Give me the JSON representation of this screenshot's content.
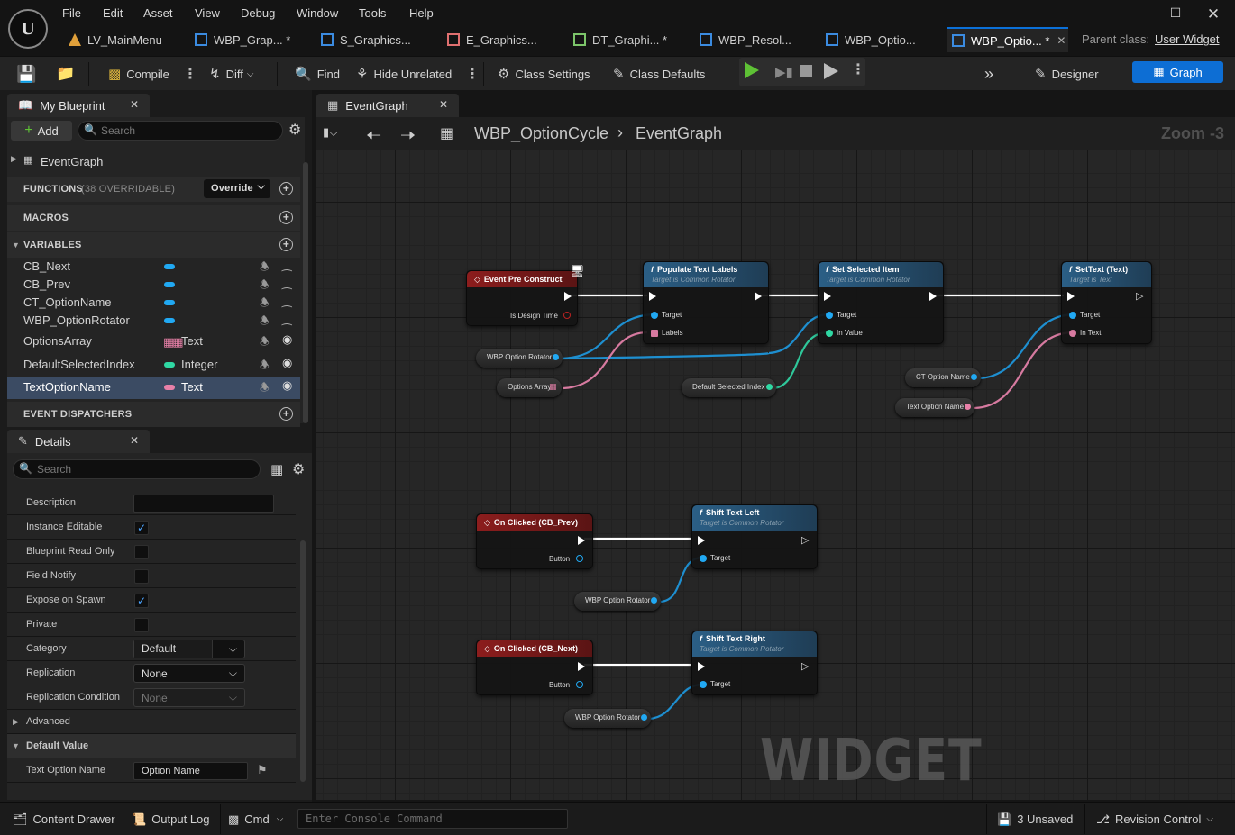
{
  "menu": [
    "File",
    "Edit",
    "Asset",
    "View",
    "Debug",
    "Window",
    "Tools",
    "Help"
  ],
  "tabs": [
    {
      "label": "LV_MainMenu",
      "color": "#e0a03a"
    },
    {
      "label": "WBP_Grap... *",
      "color": "#3b8be0"
    },
    {
      "label": "S_Graphics...",
      "color": "#3b8be0"
    },
    {
      "label": "E_Graphics...",
      "color": "#e07070"
    },
    {
      "label": "DT_Graphi... *",
      "color": "#7cc56a"
    },
    {
      "label": "WBP_Resol...",
      "color": "#3b8be0"
    },
    {
      "label": "WBP_Optio...",
      "color": "#3b8be0"
    },
    {
      "label": "WBP_Optio... *",
      "color": "#3b8be0"
    }
  ],
  "parent_class": {
    "label": "Parent class:",
    "value": "User Widget"
  },
  "toolbar": {
    "compile": "Compile",
    "diff": "Diff",
    "find": "Find",
    "hide_unrelated": "Hide Unrelated",
    "class_settings": "Class Settings",
    "class_defaults": "Class Defaults",
    "designer": "Designer",
    "graph": "Graph"
  },
  "my_blueprint": {
    "title": "My Blueprint",
    "add": "Add",
    "search_placeholder": "Search",
    "event_graph": "EventGraph",
    "functions": "FUNCTIONS",
    "functions_count": "(38 OVERRIDABLE)",
    "override": "Override",
    "macros": "MACROS",
    "variables": "VARIABLES",
    "event_dispatchers": "EVENT DISPATCHERS",
    "vars": [
      {
        "name": "CB_Next",
        "type": "",
        "color": "#21a9f3"
      },
      {
        "name": "CB_Prev",
        "type": "",
        "color": "#21a9f3"
      },
      {
        "name": "CT_OptionName",
        "type": "",
        "color": "#21a9f3"
      },
      {
        "name": "WBP_OptionRotator",
        "type": "",
        "color": "#21a9f3"
      },
      {
        "name": "OptionsArray",
        "type": "Text",
        "color": "#e880a8"
      },
      {
        "name": "DefaultSelectedIndex",
        "type": "Integer",
        "color": "#2fd8a3"
      },
      {
        "name": "TextOptionName",
        "type": "Text",
        "color": "#e880a8"
      }
    ]
  },
  "details": {
    "title": "Details",
    "search_placeholder": "Search",
    "rows": [
      {
        "label": "Description",
        "kind": "text",
        "value": ""
      },
      {
        "label": "Instance Editable",
        "kind": "check",
        "value": "✓"
      },
      {
        "label": "Blueprint Read Only",
        "kind": "check",
        "value": ""
      },
      {
        "label": "Field Notify",
        "kind": "check",
        "value": ""
      },
      {
        "label": "Expose on Spawn",
        "kind": "check",
        "value": "✓"
      },
      {
        "label": "Private",
        "kind": "check",
        "value": ""
      },
      {
        "label": "Category",
        "kind": "combo",
        "value": "Default"
      },
      {
        "label": "Replication",
        "kind": "combo",
        "value": "None"
      },
      {
        "label": "Replication Condition",
        "kind": "combo",
        "value": "None"
      }
    ],
    "advanced": "Advanced",
    "default_value": "Default Value",
    "default_field_label": "Text Option Name",
    "default_field_value": "Option Name"
  },
  "graph": {
    "tab": "EventGraph",
    "breadcrumb_asset": "WBP_OptionCycle",
    "breadcrumb_graph": "EventGraph",
    "zoom": "Zoom -3",
    "watermark": "WIDGET BLUEPRINT",
    "nodes": {
      "event_pre_construct": "Event Pre Construct",
      "is_design_time": "Is Design Time",
      "populate": "Populate Text Labels",
      "populate_sub": "Target is Common Rotator",
      "set_selected": "Set Selected Item",
      "set_selected_sub": "Target is Common Rotator",
      "settext": "SetText (Text)",
      "settext_sub": "Target is Text",
      "target": "Target",
      "labels": "Labels",
      "in_value": "In Value",
      "in_text": "In Text",
      "wbp_rotator": "WBP Option Rotator",
      "options_array": "Options Array",
      "default_index": "Default Selected Index",
      "ct_option_name": "CT Option Name",
      "text_option_name": "Text Option Name",
      "on_clicked_prev": "On Clicked (CB_Prev)",
      "on_clicked_next": "On Clicked (CB_Next)",
      "button": "Button",
      "shift_left": "Shift Text Left",
      "shift_left_sub": "Target is Common Rotator",
      "shift_right": "Shift Text Right",
      "shift_right_sub": "Target is Common Rotator"
    }
  },
  "bottom": {
    "content_drawer": "Content Drawer",
    "output_log": "Output Log",
    "cmd": "Cmd",
    "console_placeholder": "Enter Console Command",
    "unsaved": "3 Unsaved",
    "revision_control": "Revision Control"
  }
}
